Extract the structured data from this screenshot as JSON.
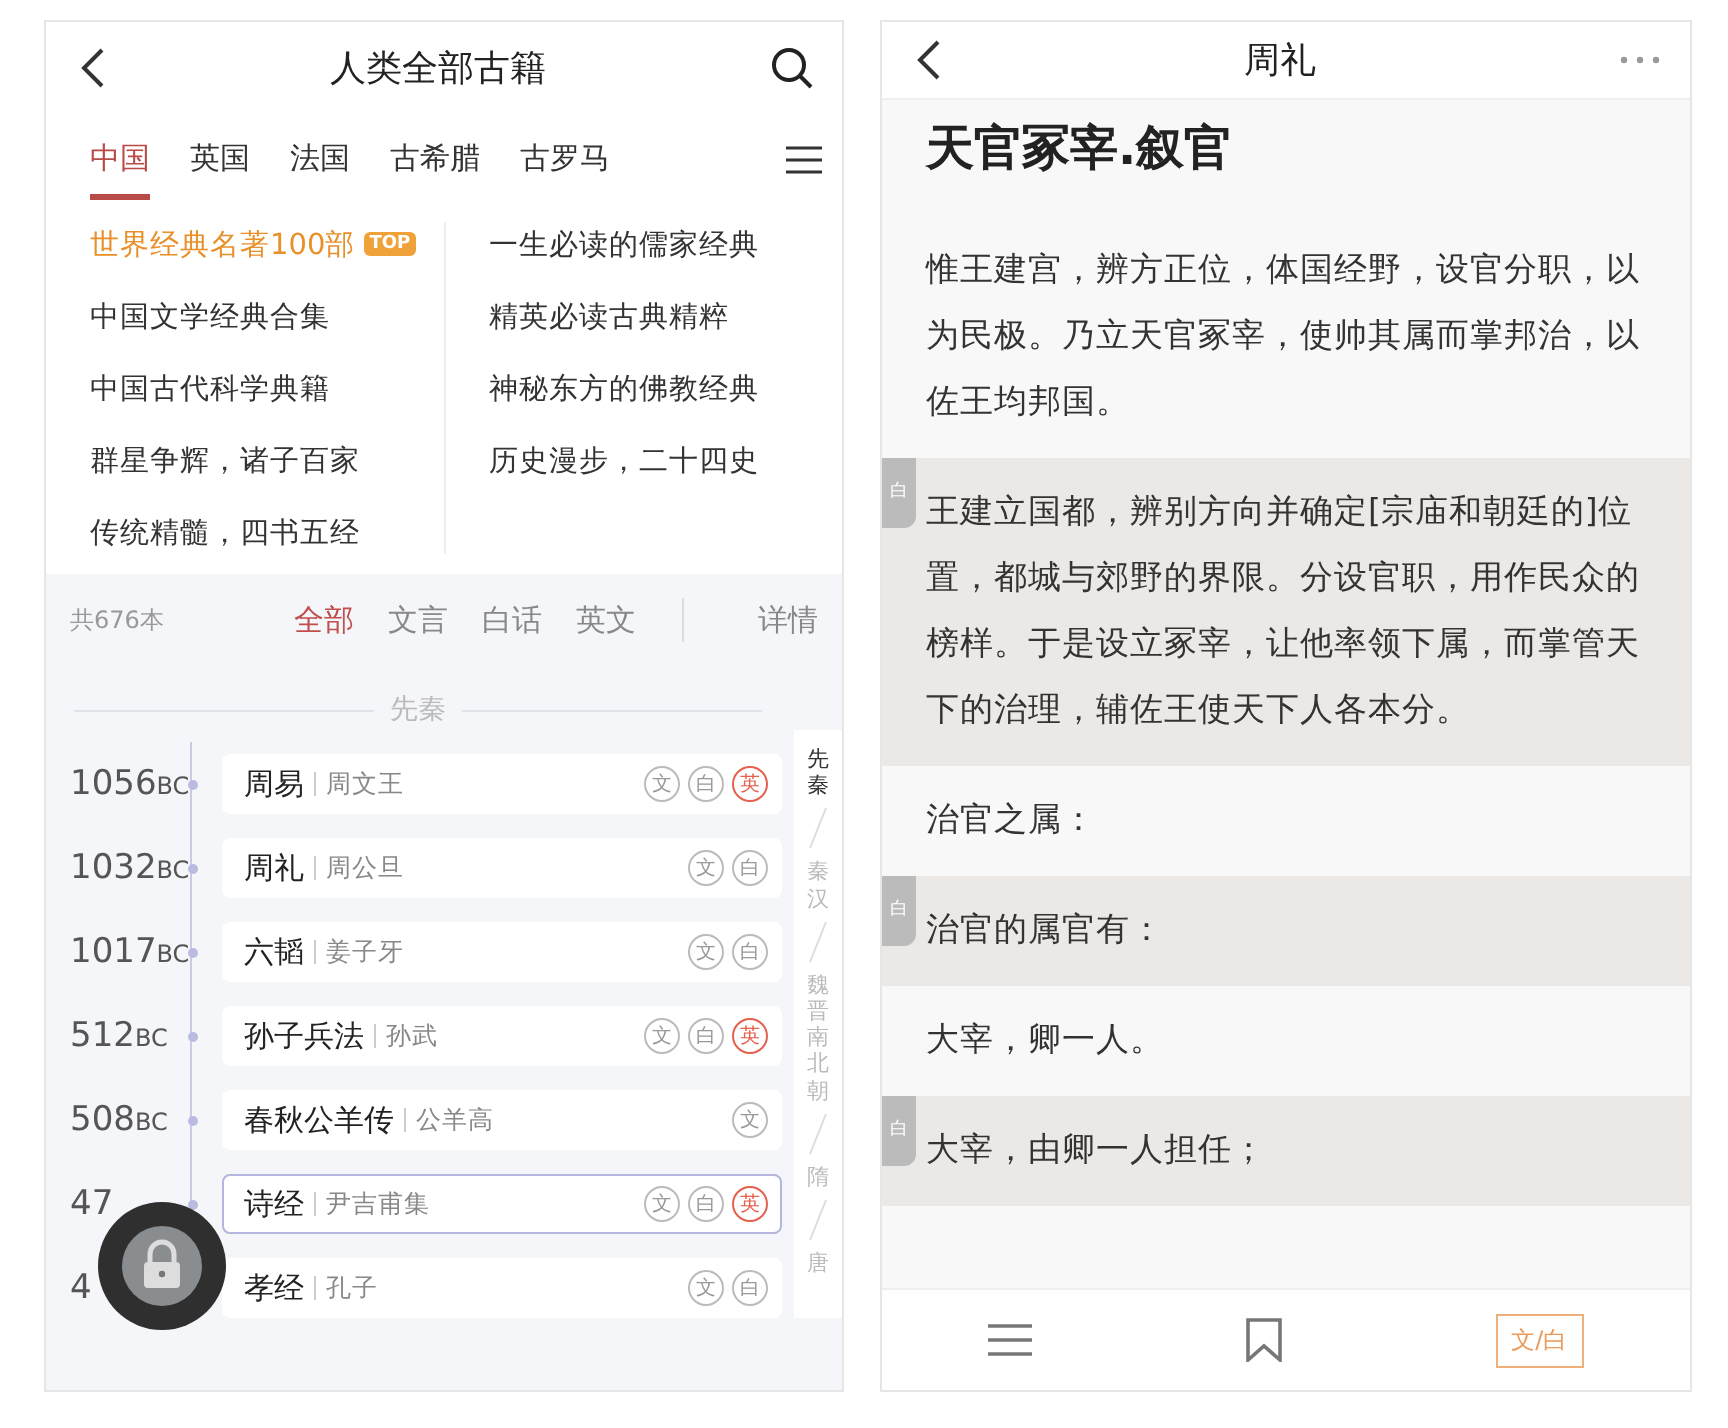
{
  "left_screen": {
    "header": {
      "title": "人类全部古籍"
    },
    "region_tabs": [
      {
        "label": "中国",
        "selected": true
      },
      {
        "label": "英国",
        "selected": false
      },
      {
        "label": "法国",
        "selected": false
      },
      {
        "label": "古希腊",
        "selected": false
      },
      {
        "label": "古罗马",
        "selected": false
      }
    ],
    "collections": {
      "column_1": [
        {
          "label": "世界经典名著100部",
          "featured": true,
          "badge": "TOP"
        },
        {
          "label": "中国文学经典合集",
          "featured": false
        },
        {
          "label": "中国古代科学典籍",
          "featured": false
        },
        {
          "label": "群星争辉，诸子百家",
          "featured": false
        },
        {
          "label": "传统精髓，四书五经",
          "featured": false
        }
      ],
      "column_2": [
        {
          "label": "一生必读的儒家经典",
          "featured": false
        },
        {
          "label": "精英必读古典精粹",
          "featured": false
        },
        {
          "label": "神秘东方的佛教经典",
          "featured": false
        },
        {
          "label": "历史漫步，二十四史",
          "featured": false
        }
      ]
    },
    "filter_bar": {
      "count": "共676本",
      "tabs": [
        {
          "label": "全部",
          "selected": true
        },
        {
          "label": "文言",
          "selected": false
        },
        {
          "label": "白话",
          "selected": false
        },
        {
          "label": "英文",
          "selected": false
        }
      ],
      "details": "详情"
    },
    "section": "先秦",
    "books": [
      {
        "year": "1056",
        "unit": "BC",
        "title": "周易",
        "author": "周文王",
        "selected": false,
        "tags": [
          {
            "label": "文",
            "kind": "plain"
          },
          {
            "label": "白",
            "kind": "plain"
          },
          {
            "label": "英",
            "kind": "accent"
          }
        ]
      },
      {
        "year": "1032",
        "unit": "BC",
        "title": "周礼",
        "author": "周公旦",
        "selected": false,
        "tags": [
          {
            "label": "文",
            "kind": "plain"
          },
          {
            "label": "白",
            "kind": "plain"
          }
        ]
      },
      {
        "year": "1017",
        "unit": "BC",
        "title": "六韬",
        "author": "姜子牙",
        "selected": false,
        "tags": [
          {
            "label": "文",
            "kind": "plain"
          },
          {
            "label": "白",
            "kind": "plain"
          }
        ]
      },
      {
        "year": "512",
        "unit": "BC",
        "title": "孙子兵法",
        "author": "孙武",
        "selected": false,
        "tags": [
          {
            "label": "文",
            "kind": "plain"
          },
          {
            "label": "白",
            "kind": "plain"
          },
          {
            "label": "英",
            "kind": "accent"
          }
        ]
      },
      {
        "year": "508",
        "unit": "BC",
        "title": "春秋公羊传",
        "author": "公羊高",
        "selected": false,
        "tags": [
          {
            "label": "文",
            "kind": "plain"
          }
        ]
      },
      {
        "year": "47",
        "title": "诗经",
        "author": "尹吉甫集",
        "selected": true,
        "tags": [
          {
            "label": "文",
            "kind": "plain"
          },
          {
            "label": "白",
            "kind": "plain"
          },
          {
            "label": "英",
            "kind": "accent"
          }
        ]
      },
      {
        "year": "4",
        "title": "孝经",
        "author": "孔子",
        "selected": false,
        "tags": [
          {
            "label": "文",
            "kind": "plain"
          },
          {
            "label": "白",
            "kind": "plain"
          }
        ]
      }
    ],
    "eras": [
      {
        "label": "先秦",
        "selected": true
      },
      {
        "label": "秦汉",
        "selected": false
      },
      {
        "label": "魏晋南北朝",
        "selected": false
      },
      {
        "label": "隋",
        "selected": false
      },
      {
        "label": "唐",
        "selected": false
      }
    ]
  },
  "right_screen": {
    "header": {
      "title": "周礼"
    },
    "chapter_title": "天官冢宰.叙官",
    "paragraphs": [
      {
        "kind": "original",
        "text": "惟王建宫，辨方正位，体国经野，设官分职，以为民极。乃立天官冢宰，使帅其属而掌邦治，以佐王均邦国。"
      },
      {
        "kind": "translation",
        "tag": "白",
        "text": "王建立国都，辨别方向并确定[宗庙和朝廷的]位置，都城与郊野的界限。分设官职，用作民众的榜样。于是设立冢宰，让他率领下属，而掌管天下的治理，辅佐王使天下人各本分。"
      },
      {
        "kind": "original",
        "text": "治官之属："
      },
      {
        "kind": "translation",
        "tag": "白",
        "text": "治官的属官有："
      },
      {
        "kind": "original",
        "text": "大宰，卿一人。"
      },
      {
        "kind": "translation",
        "tag": "白",
        "text": "大宰，由卿一人担任；"
      }
    ],
    "toolbar": {
      "toggle": "文/白"
    }
  }
}
